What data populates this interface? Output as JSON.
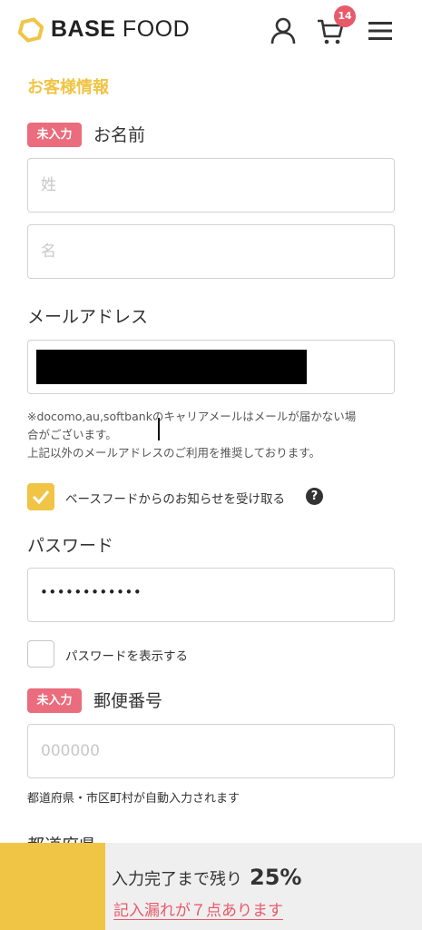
{
  "header": {
    "logo_bold": "BASE",
    "logo_light": "FOOD",
    "cart_count": "14"
  },
  "form": {
    "section_title": "お客様情報",
    "required_badge": "未入力",
    "name": {
      "label": "お名前",
      "last_placeholder": "姓",
      "first_placeholder": "名"
    },
    "email": {
      "label": "メールアドレス",
      "note_line1": "※docomo,au,softbankのキャリアメールはメールが届かない場",
      "note_line2": "合がございます。",
      "note_line3": "上記以外のメールアドレスのご利用を推奨しております。"
    },
    "newsletter": {
      "label": "ベースフードからのお知らせを受け取る",
      "checked": true,
      "help": "?"
    },
    "password": {
      "label": "パスワード",
      "value": "••••••••••••",
      "show_label": "パスワードを表示する"
    },
    "postal": {
      "label": "郵便番号",
      "placeholder": "000000",
      "note": "都道府県・市区町村が自動入力されます"
    },
    "prefecture": {
      "label": "都道府県"
    }
  },
  "bottom_bar": {
    "progress_text": "入力完了まで残り",
    "progress_percent": "25%",
    "progress_value": 0.25,
    "missing_link": "記入漏れが７点あります"
  },
  "colors": {
    "accent": "#f0c445",
    "alert": "#ea6c7d",
    "badge": "#e85a6a"
  }
}
